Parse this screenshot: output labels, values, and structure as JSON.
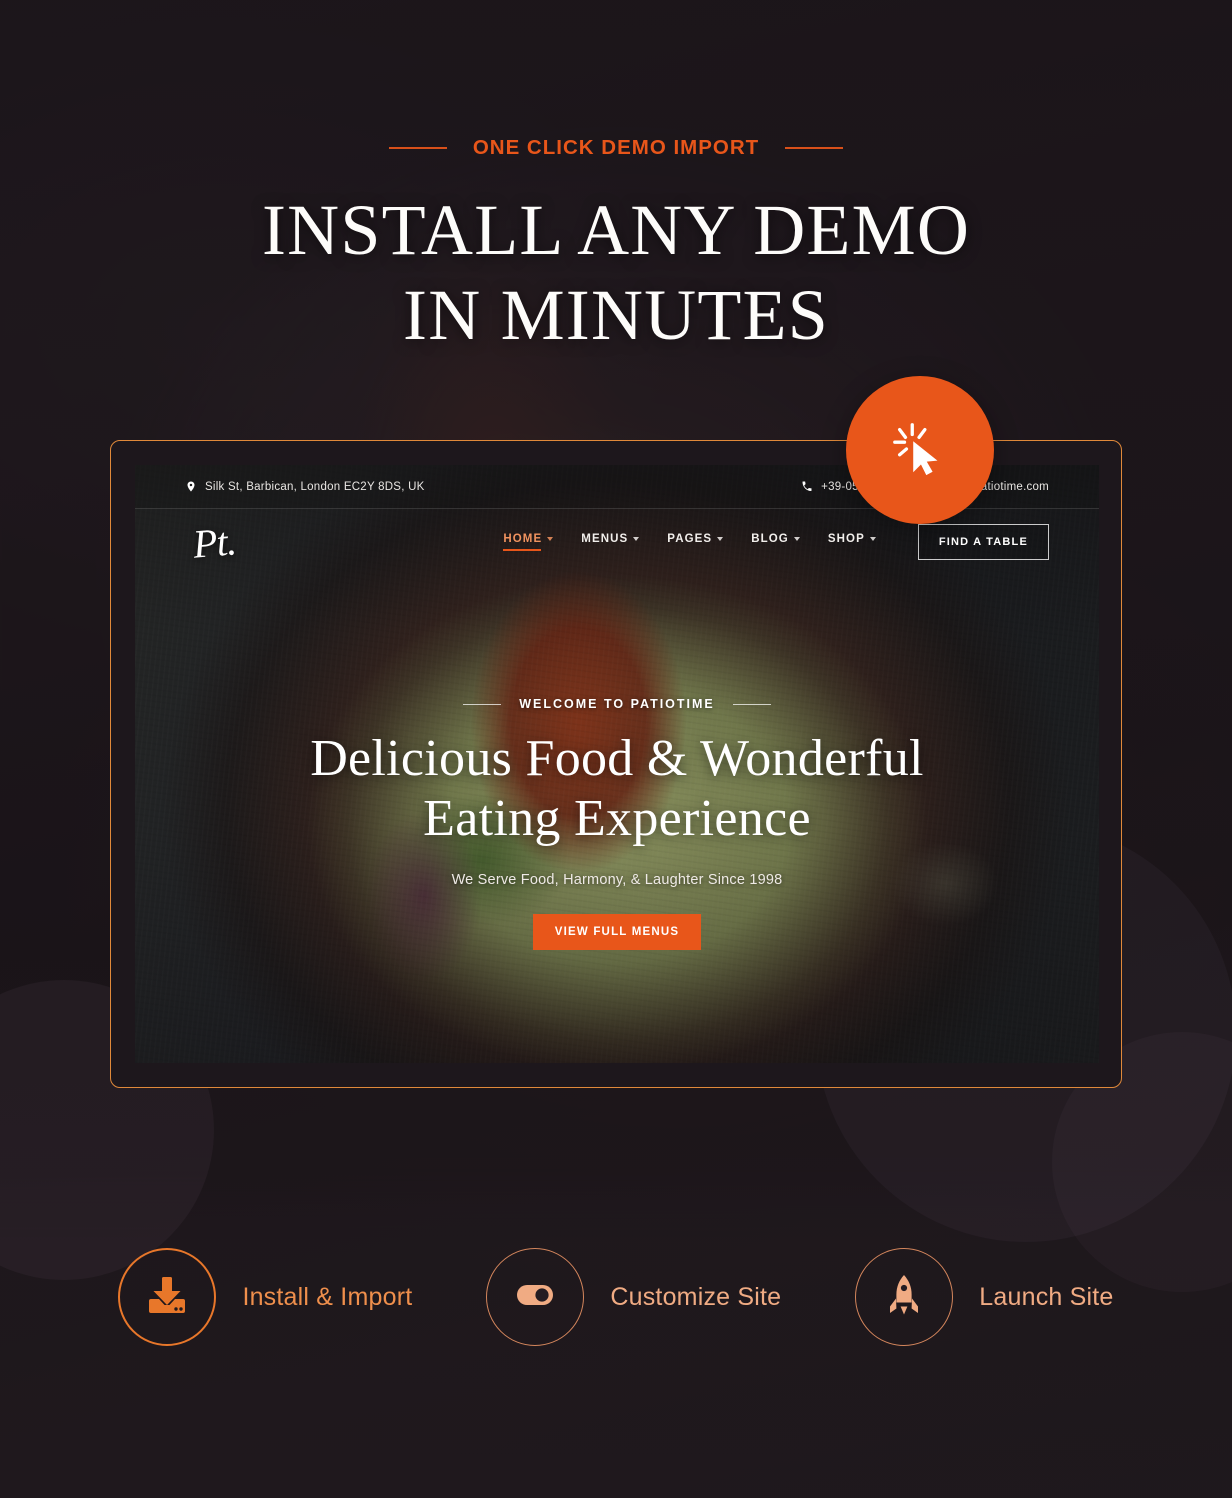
{
  "promo": {
    "eyebrow": "ONE CLICK DEMO IMPORT",
    "title_line1": "INSTALL ANY DEMO",
    "title_line2": "IN MINUTES",
    "accent_color": "#e8561a",
    "badge_icon": "click-cursor-icon"
  },
  "demo_site": {
    "topbar": {
      "location_icon": "map-pin-icon",
      "address": "Silk St, Barbican, London EC2Y 8DS, UK",
      "phone_icon": "phone-icon",
      "phone": "+39-055-1...",
      "email": "...ooking@patiotime.com"
    },
    "brand": {
      "logo_text": "Pt.",
      "logo_name": "patiotime-logo"
    },
    "nav": {
      "items": [
        {
          "label": "HOME",
          "has_caret": true,
          "active": true
        },
        {
          "label": "MENUS",
          "has_caret": true,
          "active": false
        },
        {
          "label": "PAGES",
          "has_caret": true,
          "active": false
        },
        {
          "label": "BLOG",
          "has_caret": true,
          "active": false
        },
        {
          "label": "SHOP",
          "has_caret": true,
          "active": false
        }
      ],
      "cta_label": "FIND A TABLE"
    },
    "hero": {
      "eyebrow": "WELCOME TO PATIOTIME",
      "title_line1": "Delicious Food & Wonderful",
      "title_line2": "Eating Experience",
      "subtitle": "We Serve Food, Harmony, & Laughter Since 1998",
      "button_label": "VIEW FULL MENUS",
      "button_color": "#e8561a"
    }
  },
  "steps": [
    {
      "icon": "download-import-icon",
      "label": "Install & Import",
      "color": "#ef8f4c"
    },
    {
      "icon": "toggle-switch-icon",
      "label": "Customize Site",
      "color": "#f0ab83"
    },
    {
      "icon": "rocket-icon",
      "label": "Launch Site",
      "color": "#f0ab83"
    }
  ]
}
